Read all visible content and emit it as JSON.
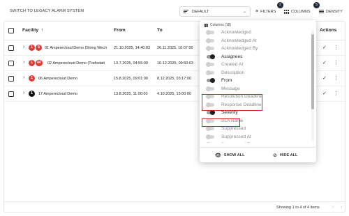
{
  "toolbar": {
    "legacy_link": "SWITCH TO LEGACY ALARM SYSTEM",
    "view_select": "DEFAULT",
    "filters_label": "FILTERS",
    "filters_count": "2",
    "columns_label": "COLUMNS",
    "columns_count": "5",
    "density_label": "DENSITY"
  },
  "table": {
    "headers": {
      "facility": "Facility",
      "sort_indicator": "↑",
      "from": "From",
      "to": "To",
      "actions": "Actions"
    },
    "rows": [
      {
        "severity_a": "1",
        "severity_b": "6",
        "facility": "01 Amperecloud Demo (String Wech",
        "from": "21.10.2025, 14:40:03",
        "to": "26.11.2025, 10:07:00"
      },
      {
        "severity_a": "1",
        "severity_b": "44",
        "facility": "02 Amperecloud Demo (Trafostati",
        "from": "13.7.2025, 04:55:00",
        "to": "10.12.2025, 09:50:03"
      },
      {
        "severity_a": "1",
        "facility": "06 Amperecloud Demo",
        "from": "15.8.2025, 09:01:00",
        "to": "8.12.2025, 03:17:00"
      },
      {
        "severity_a": "1",
        "facility": "17 Amperecloud Demo",
        "from": "13.8.2025, 11:00:00",
        "to": "4.10.2025, 15:00:00"
      }
    ],
    "row_action_icons": [
      "check-icon",
      "more-vert-icon"
    ]
  },
  "columns_panel": {
    "title": "Columns (18)",
    "items": [
      {
        "label": "Acknowledged",
        "visible": false
      },
      {
        "label": "Acknowledged At",
        "visible": false
      },
      {
        "label": "Acknowledged By",
        "visible": false
      },
      {
        "label": "Assignees",
        "visible": true
      },
      {
        "label": "Created At",
        "visible": false
      },
      {
        "label": "Description",
        "visible": false
      },
      {
        "label": "From",
        "visible": true
      },
      {
        "label": "Message",
        "visible": false
      },
      {
        "label": "Resolution Deadline",
        "visible": false
      },
      {
        "label": "Response Deadline",
        "visible": false
      },
      {
        "label": "Severity",
        "visible": true
      },
      {
        "label": "SLA Name",
        "visible": false
      },
      {
        "label": "Suppressed",
        "visible": false
      },
      {
        "label": "Suppressed At",
        "visible": false
      },
      {
        "label": "Suppressed By",
        "visible": false
      }
    ],
    "show_all_label": "SHOW ALL",
    "hide_all_label": "HIDE ALL"
  },
  "pagination": {
    "text": "Showing 1 to 4 of 4 items"
  },
  "colors": {
    "severity_red": "#e53935",
    "severity_dark": "#111111",
    "highlight": "#d32222",
    "badge": "#1f2937"
  }
}
